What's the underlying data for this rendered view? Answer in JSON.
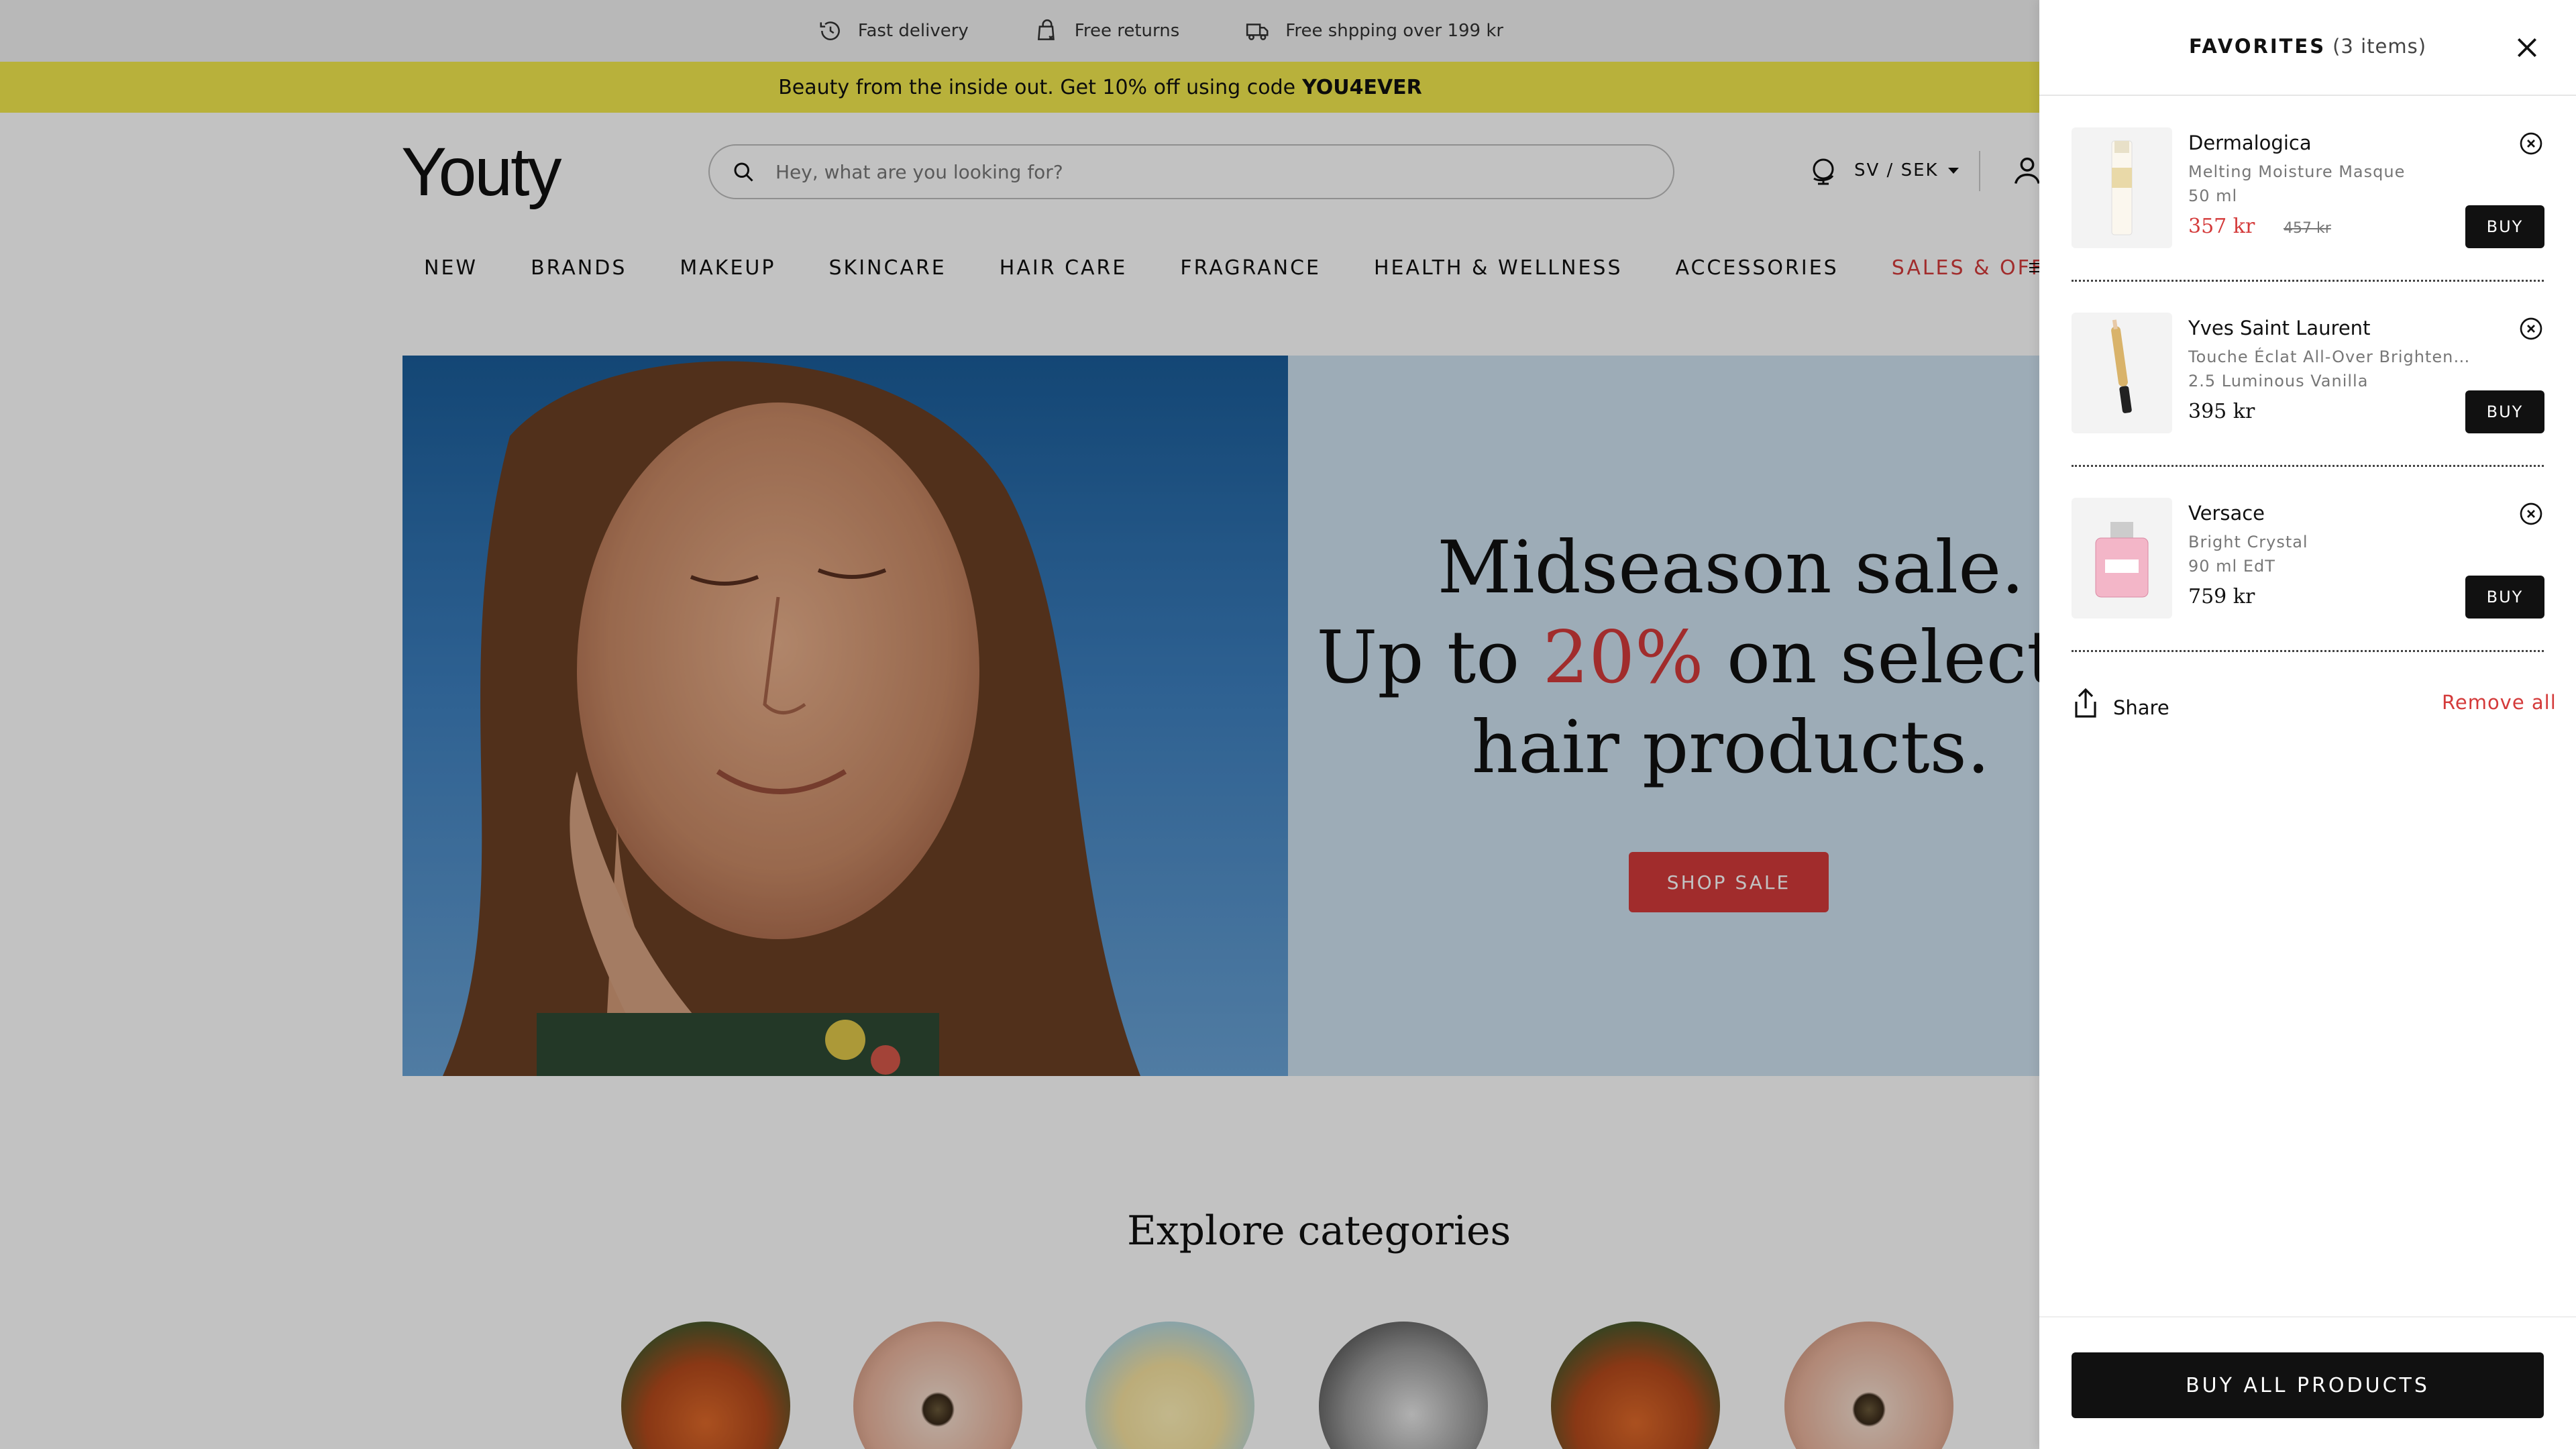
{
  "utility_bar": {
    "items": [
      {
        "label": "Fast delivery",
        "icon": "clock-delivery-icon"
      },
      {
        "label": "Free returns",
        "icon": "return-bag-icon"
      },
      {
        "label": "Free shpping over 199 kr",
        "icon": "truck-icon"
      }
    ]
  },
  "promo": {
    "text": "Beauty from the inside out. Get 10% off using code",
    "code": "YOU4EVER"
  },
  "header": {
    "logo": "Youty",
    "search_placeholder": "Hey, what are you looking for?",
    "locale": "SV / SEK"
  },
  "nav": {
    "items": [
      "NEW",
      "BRANDS",
      "MAKEUP",
      "SKINCARE",
      "HAIR CARE",
      "FRAGRANCE",
      "HEALTH & WELLNESS",
      "ACCESSORIES"
    ],
    "sale_item": "SALES & OFFERS"
  },
  "hero": {
    "line1": "Midseason sale.",
    "line2_pre": "Up to",
    "line2_pct": "20%",
    "line2_post": "on selected",
    "line3": "hair products.",
    "cta": "SHOP SALE"
  },
  "explore": {
    "title": "Explore categories"
  },
  "favorites": {
    "title": "FAVORITES",
    "count": "(3 items)",
    "items": [
      {
        "brand": "Dermalogica",
        "name": "Melting Moisture Masque",
        "variant": "50 ml",
        "price": "357 kr",
        "old_price": "457 kr",
        "buy": "BUY"
      },
      {
        "brand": "Yves Saint Laurent",
        "name": "Touche Éclat All-Over Brightening Pen",
        "variant": "2.5 Luminous Vanilla",
        "price": "395 kr",
        "buy": "BUY"
      },
      {
        "brand": "Versace",
        "name": "Bright Crystal",
        "variant": "90 ml EdT",
        "price": "759 kr",
        "buy": "BUY"
      }
    ],
    "share": "Share",
    "remove_all": "Remove all",
    "buy_all": "BUY ALL PRODUCTS"
  },
  "colors": {
    "accent_red": "#d43a3a",
    "promo_yellow": "#f2e94e",
    "dark": "#111111"
  }
}
